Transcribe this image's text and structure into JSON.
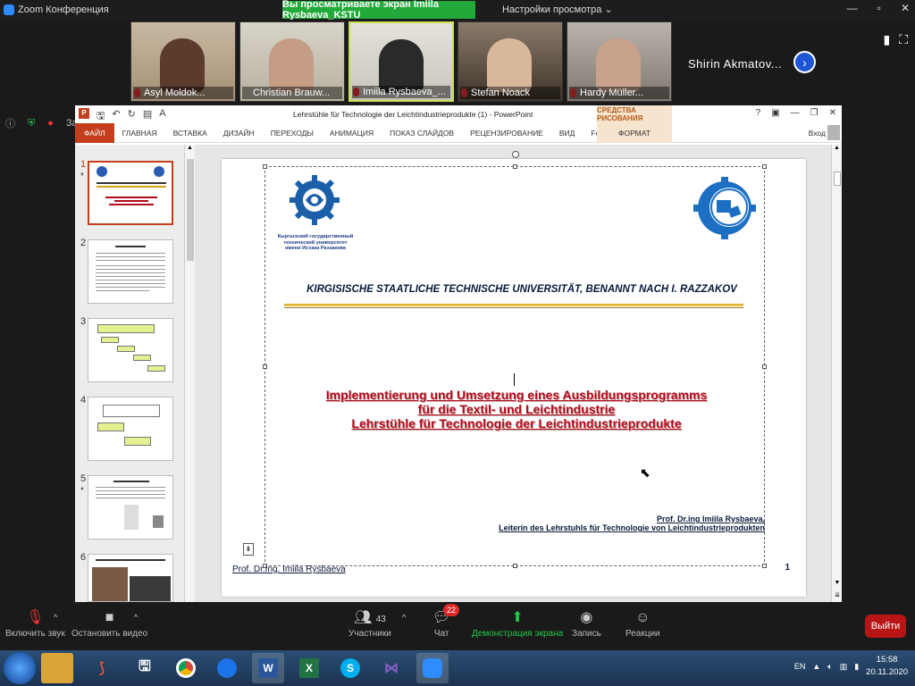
{
  "zoom": {
    "app_title": "Zoom Конференция",
    "share_banner": "Вы просматриваете экран Imiila Rysbaeva_KSTU",
    "view_settings": "Настройки просмотра ⌄",
    "featured_name": "Shirin  Akmatov...",
    "participants": [
      {
        "name": "Asyl Moldok..."
      },
      {
        "name": "Christian Brauw..."
      },
      {
        "name": "Imiila Rysbaeva_..."
      },
      {
        "name": "Stefan Noack"
      },
      {
        "name": "Hardy Müller..."
      }
    ],
    "sidebar_text": "Запись",
    "controls": {
      "unmute": "Включить звук",
      "start_video": "Остановить видео",
      "participants_label": "Участники",
      "participants_count": "43",
      "chat_label": "Чат",
      "chat_badge": "22",
      "share_label": "Демонстрация экрана",
      "record_label": "Запись",
      "reactions_label": "Реакции",
      "leave_label": "Выйти"
    }
  },
  "ppt": {
    "doc_title": "Lehrstühle für Technologie der Leichtindustrieprodukte (1) - PowerPoint",
    "drawing_tools": "СРЕДСТВА РИСОВАНИЯ",
    "tabs": {
      "file": "ФАЙЛ",
      "home": "ГЛАВНАЯ",
      "insert": "ВСТАВКА",
      "design": "ДИЗАЙН",
      "transitions": "ПЕРЕХОДЫ",
      "animation": "АНИМАЦИЯ",
      "slideshow": "ПОКАЗ СЛАЙДОВ",
      "review": "РЕЦЕНЗИРОВАНИЕ",
      "view": "ВИД",
      "foxit": "Foxit Reader PDF",
      "format": "ФОРМАТ"
    },
    "login": "Вход",
    "thumbnails": [
      {
        "num": "1",
        "star": "*"
      },
      {
        "num": "2",
        "star": ""
      },
      {
        "num": "3",
        "star": ""
      },
      {
        "num": "4",
        "star": ""
      },
      {
        "num": "5",
        "star": "*"
      },
      {
        "num": "6",
        "star": ""
      }
    ],
    "slide": {
      "uni_logo_text_1": "Кыргызский государственный",
      "uni_logo_text_2": "технический университет",
      "uni_logo_text_3": "имени Исхака Раззакова",
      "university": "KIRGISISCHE STAATLICHE TECHNISCHE UNIVERSITÄT, BENANNT NACH I. RAZZAKOV",
      "title_line1": "Implementierung und Umsetzung eines Ausbildungsprogramms",
      "title_line2": "für die Textil- und Leichtindustrie",
      "title_line3": "Lehrstühle für Technologie der Leichtindustrieprodukte",
      "author_line1": "Prof. Dr.ing Imiila Rysbaeva,",
      "author_line2": "Leiterin des Lehrstuhls für Technologie von Leichtindustrieprodukten",
      "footer_author": "Prof. Dr.Ing. Imiila Rysbaeva",
      "page_number": "1"
    }
  },
  "taskbar": {
    "lang": "EN",
    "time": "15:58",
    "date": "20.11.2020"
  },
  "colors": {
    "zoom_green": "#23a93a",
    "ppt_accent": "#c43e1c",
    "title_red": "#b10d1d"
  }
}
